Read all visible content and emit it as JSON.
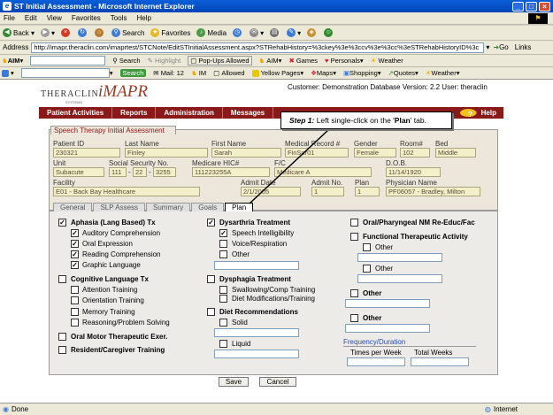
{
  "window": {
    "title": "ST Initial Assessment - Microsoft Internet Explorer"
  },
  "menu": [
    "File",
    "Edit",
    "View",
    "Favorites",
    "Tools",
    "Help"
  ],
  "toolbar": {
    "back": "Back",
    "search": "Search",
    "favorites": "Favorites",
    "media": "Media"
  },
  "address": {
    "label": "Address",
    "url": "http://imapr.theraclin.com/imaprtest/STCNote/EditSTInitialAssessment.aspx?STRehabHistory=%3ckey%3e%3ccv%3e%3cc%3eSTRehabHistoryID%3c",
    "go": "Go",
    "links": "Links"
  },
  "aimbar": {
    "aim": "AIM",
    "search": "Search",
    "highlight": "Highlight",
    "popups": "Pop-Ups Allowed",
    "aim2": "AIM",
    "games": "Games",
    "personals": "Personals",
    "weather": "Weather"
  },
  "linkbar": {
    "search": "Search",
    "mail": "Mail: 12",
    "im": "IM",
    "allowed": "Allowed",
    "yellow": "Yellow Pages",
    "maps": "Maps",
    "shopping": "Shopping",
    "quotes": "Quotes",
    "weather": "Weather"
  },
  "logo": {
    "company": "THERACLIN",
    "product": "iMAPR",
    "tag": "SYSTEMS"
  },
  "customer_line": "Customer: Demonstration Database  Version: 2.2  User: theraclin",
  "nav": [
    "Patient Activities",
    "Reports",
    "Administration",
    "Messages"
  ],
  "help": "Help",
  "callout": {
    "step": "Step 1:",
    "pre": " Left single-click on the '",
    "target": "Plan",
    "post": "' tab."
  },
  "form_title": "Speech Therapy Initial Assessment",
  "fields": {
    "patient_id": {
      "label": "Patient ID",
      "value": "230321"
    },
    "last_name": {
      "label": "Last Name",
      "value": "Finley"
    },
    "first_name": {
      "label": "First Name",
      "value": "Sarah"
    },
    "medical_record": {
      "label": "Medical Record #",
      "value": "FinSar01"
    },
    "gender": {
      "label": "Gender",
      "value": "Female"
    },
    "room": {
      "label": "Room#",
      "value": "102"
    },
    "bed": {
      "label": "Bed",
      "value": "Middle"
    },
    "unit": {
      "label": "Unit",
      "value": "Subacute"
    },
    "ssn": {
      "label": "Social Security No.",
      "v1": "111",
      "v2": "22",
      "v3": "3255"
    },
    "medicare": {
      "label": "Medicare HIC#",
      "value": "111223255A"
    },
    "fc": {
      "label": "F/C",
      "value": "Medicare A"
    },
    "dob": {
      "label": "D.O.B.",
      "value": "11/14/1920"
    },
    "facility": {
      "label": "Facility",
      "value": "E01 - Back Bay Healthcare"
    },
    "admit_date": {
      "label": "Admit Date",
      "value": "2/1/2005"
    },
    "admit_no": {
      "label": "Admit No.",
      "value": "1"
    },
    "plan": {
      "label": "Plan",
      "value": "1"
    },
    "physician": {
      "label": "Physician Name",
      "value": "PF06057 - Bradley, Milton"
    }
  },
  "tabs": [
    "General",
    "SLP Assess",
    "Summary",
    "Goals",
    "Plan"
  ],
  "plan": {
    "col1": {
      "aphasia": "Aphasia (Lang Based) Tx",
      "auditory": "Auditory Comprehension",
      "oral": "Oral Expression",
      "reading": "Reading Comprehension",
      "graphic": "Graphic Language",
      "cognitive": "Cognitive Language Tx",
      "attention": "Attention Training",
      "orientation": "Orientation Training",
      "memory": "Memory Training",
      "reasoning": "Reasoning/Problem Solving",
      "oral_motor": "Oral Motor Therapeutic Exer.",
      "resident": "Resident/Caregiver Training"
    },
    "col2": {
      "dysarthria": "Dysarthria Treatment",
      "speech": "Speech Intelligibility",
      "voice": "Voice/Respiration",
      "other": "Other",
      "dysphagia": "Dysphagia Treatment",
      "swallowing": "Swallowing/Comp Training",
      "diet_mod": "Diet Modifications/Training",
      "diet_rec": "Diet Recommendations",
      "solid": "Solid",
      "liquid": "Liquid"
    },
    "col3": {
      "oral_phar": "Oral/Pharyngeal NM Re-Educ/Fac",
      "functional": "Functional Therapeutic Activity",
      "other1": "Other",
      "other2": "Other",
      "other3": "Other",
      "other4": "Other",
      "freq": "Frequency/Duration",
      "times": "Times per Week",
      "total": "Total Weeks"
    }
  },
  "buttons": {
    "save": "Save",
    "cancel": "Cancel"
  },
  "status": {
    "done": "Done",
    "zone": "Internet"
  }
}
